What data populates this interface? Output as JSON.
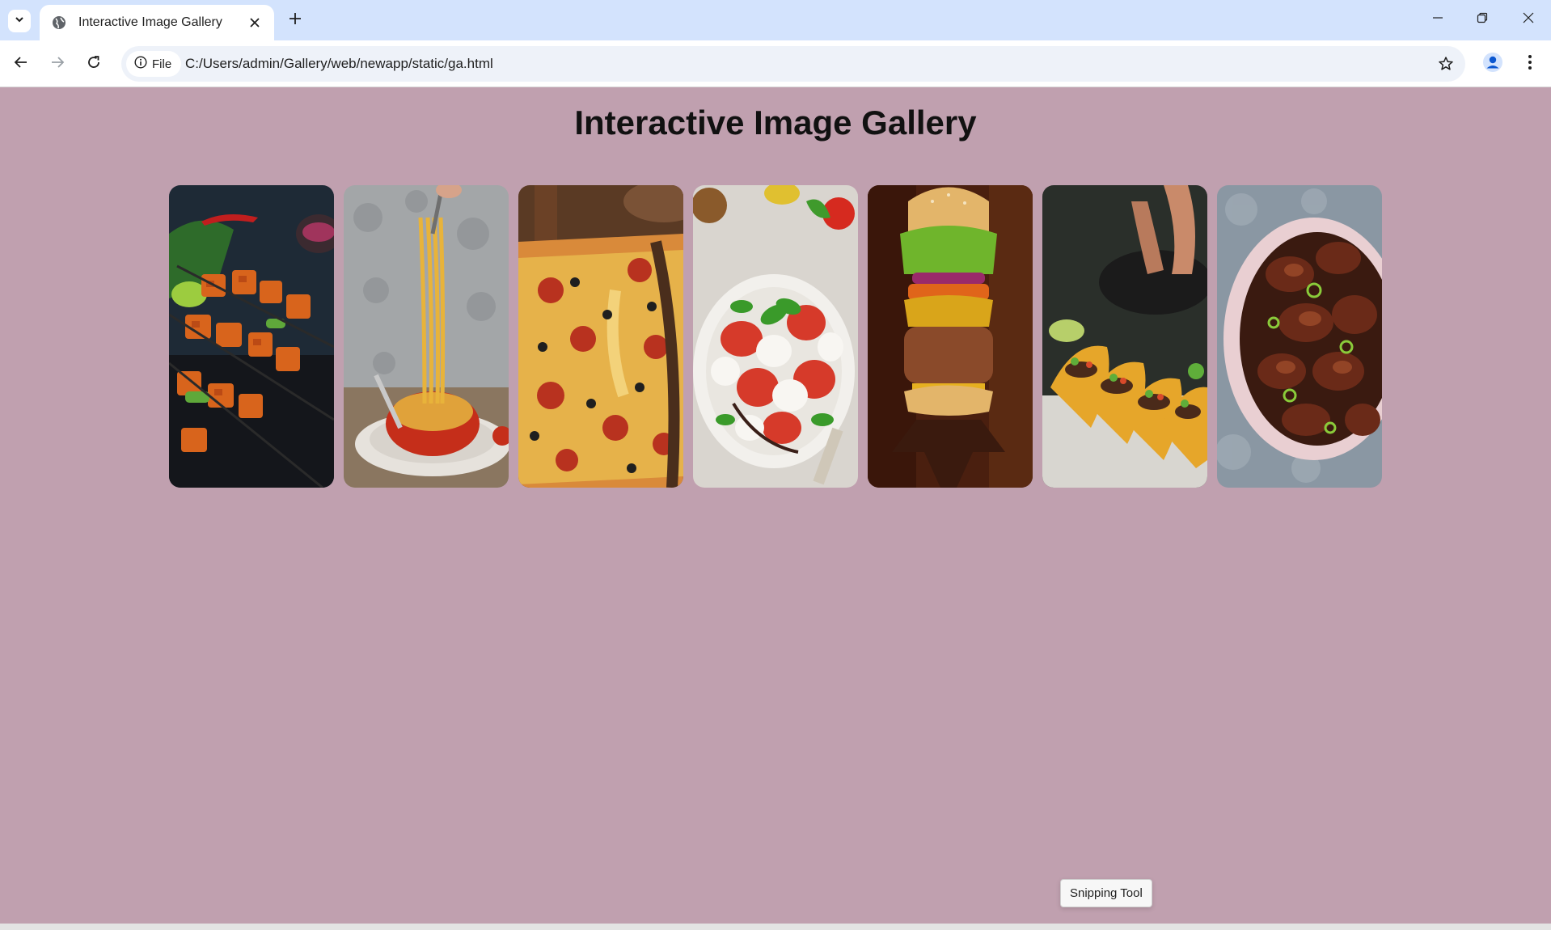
{
  "browser": {
    "tab_title": "Interactive Image Gallery",
    "address_chip": "File",
    "url": "C:/Users/admin/Gallery/web/newapp/static/ga.html"
  },
  "page": {
    "title": "Interactive Image Gallery"
  },
  "gallery": {
    "items": [
      {
        "name": "paneer-tikka-skewers"
      },
      {
        "name": "spaghetti-with-tomato-sauce"
      },
      {
        "name": "pepperoni-olive-pizza"
      },
      {
        "name": "caprese-salad"
      },
      {
        "name": "burger"
      },
      {
        "name": "tacos"
      },
      {
        "name": "grilled-chicken-bowl"
      }
    ]
  },
  "tooltip": {
    "text": "Snipping Tool"
  },
  "colors": {
    "page_background": "#c0a0af",
    "tabstrip": "#d3e3fd"
  }
}
